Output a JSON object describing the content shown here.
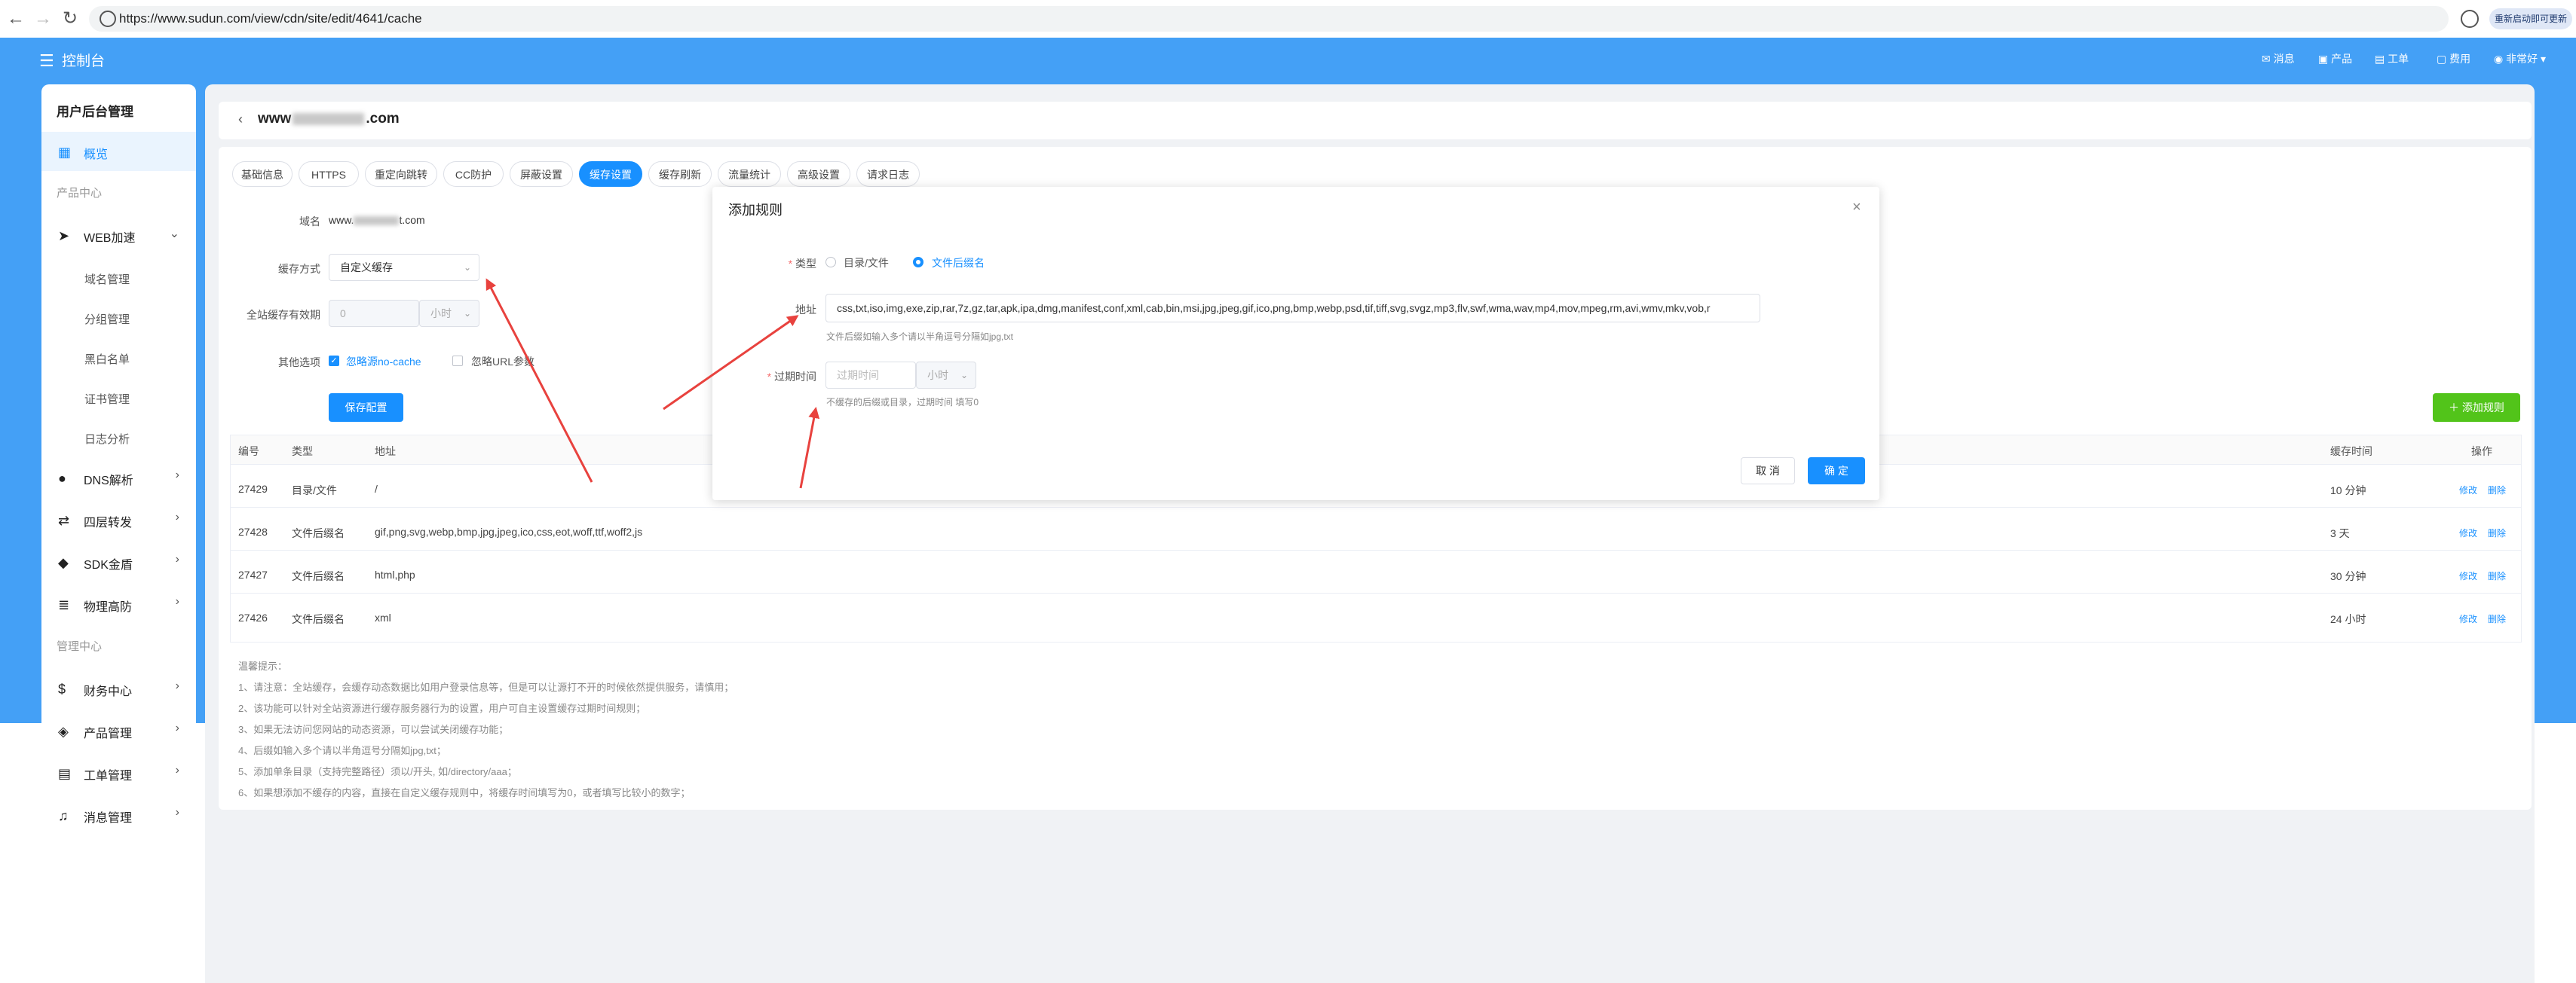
{
  "browser": {
    "url": "https://www.sudun.com/view/cdn/site/edit/4641/cache",
    "restart_label": "重新启动即可更新"
  },
  "header": {
    "title": "控制台",
    "right_items": [
      "消息",
      "产品",
      "工单",
      "费用",
      "非常好"
    ]
  },
  "sidebar": {
    "title": "用户后台管理",
    "items": [
      {
        "label": "概览",
        "icon": "grid-icon"
      },
      {
        "label": "产品中心"
      },
      {
        "label": "WEB加速",
        "icon": "paper-plane-icon"
      },
      {
        "label": "域名管理"
      },
      {
        "label": "分组管理"
      },
      {
        "label": "黑白名单"
      },
      {
        "label": "证书管理"
      },
      {
        "label": "日志分析"
      },
      {
        "label": "DNS解析",
        "icon": "globe-icon"
      },
      {
        "label": "四层转发",
        "icon": "forward-icon"
      },
      {
        "label": "SDK金盾",
        "icon": "shield-icon"
      },
      {
        "label": "物理高防",
        "icon": "server-icon"
      },
      {
        "label": "管理中心"
      },
      {
        "label": "财务中心",
        "icon": "dollar-icon"
      },
      {
        "label": "产品管理",
        "icon": "cubes-icon"
      },
      {
        "label": "工单管理",
        "icon": "ticket-icon"
      },
      {
        "label": "消息管理",
        "icon": "bell-icon"
      }
    ]
  },
  "site": {
    "domain_prefix": "www",
    "domain_suffix": ".com"
  },
  "tabs": [
    "基础信息",
    "HTTPS",
    "重定向跳转",
    "CC防护",
    "屏蔽设置",
    "缓存设置",
    "缓存刷新",
    "流量统计",
    "高级设置",
    "请求日志"
  ],
  "form": {
    "domain_label": "域名",
    "domain_value_prefix": "www.",
    "domain_value_suffix": "t.com",
    "cache_mode_label": "缓存方式",
    "cache_mode_value": "自定义缓存",
    "ttl_label": "全站缓存有效期",
    "ttl_value": "0",
    "ttl_unit": "小时",
    "options_label": "其他选项",
    "option1": "忽略源no-cache",
    "option2": "忽略URL参数",
    "save_label": "保存配置",
    "add_rule_label": "添加规则"
  },
  "table": {
    "headers": [
      "编号",
      "类型",
      "地址",
      "缓存时间",
      "操作"
    ],
    "rows": [
      {
        "id": "27429",
        "type": "目录/文件",
        "addr": "/",
        "time": "10 分钟",
        "edit": "修改",
        "del": "删除"
      },
      {
        "id": "27428",
        "type": "文件后缀名",
        "addr": "gif,png,svg,webp,bmp,jpg,jpeg,ico,css,eot,woff,ttf,woff2,js",
        "time": "3 天",
        "edit": "修改",
        "del": "删除"
      },
      {
        "id": "27427",
        "type": "文件后缀名",
        "addr": "html,php",
        "time": "30 分钟",
        "edit": "修改",
        "del": "删除"
      },
      {
        "id": "27426",
        "type": "文件后缀名",
        "addr": "xml",
        "time": "24 小时",
        "edit": "修改",
        "del": "删除"
      }
    ]
  },
  "tips": [
    "温馨提示：",
    "1、请注意：全站缓存，会缓存动态数据比如用户登录信息等，但是可以让源打不开的时候依然提供服务，请慎用；",
    "2、该功能可以针对全站资源进行缓存服务器行为的设置，用户可自主设置缓存过期时间规则；",
    "3、如果无法访问您网站的动态资源，可以尝试关闭缓存功能；",
    "4、后缀如输入多个请以半角逗号分隔如jpg,txt；",
    "5、添加单条目录（支持完整路径）须以/开头, 如/directory/aaa；",
    "6、如果想添加不缓存的内容，直接在自定义缓存规则中，将缓存时间填写为0，或者填写比较小的数字；"
  ],
  "dialog": {
    "title": "添加规则",
    "type_label": "类型",
    "type_option1": "目录/文件",
    "type_option2": "文件后缀名",
    "addr_label": "地址",
    "addr_value": "css,txt,iso,img,exe,zip,rar,7z,gz,tar,apk,ipa,dmg,manifest,conf,xml,cab,bin,msi,jpg,jpeg,gif,ico,png,bmp,webp,psd,tif,tiff,svg,svgz,mp3,flv,swf,wma,wav,mp4,mov,mpeg,rm,avi,wmv,mkv,vob,r",
    "addr_hint": "文件后缀如输入多个请以半角逗号分隔如jpg,txt",
    "expire_label": "过期时间",
    "expire_placeholder": "过期时间",
    "expire_unit": "小时",
    "expire_hint": "不缓存的后缀或目录，过期时间 填写0",
    "cancel_label": "取 消",
    "ok_label": "确 定"
  },
  "colors": {
    "brand_blue": "#44a0f6",
    "primary": "#1890ff",
    "green": "#52c41a",
    "arrow_red": "#e8423e"
  }
}
